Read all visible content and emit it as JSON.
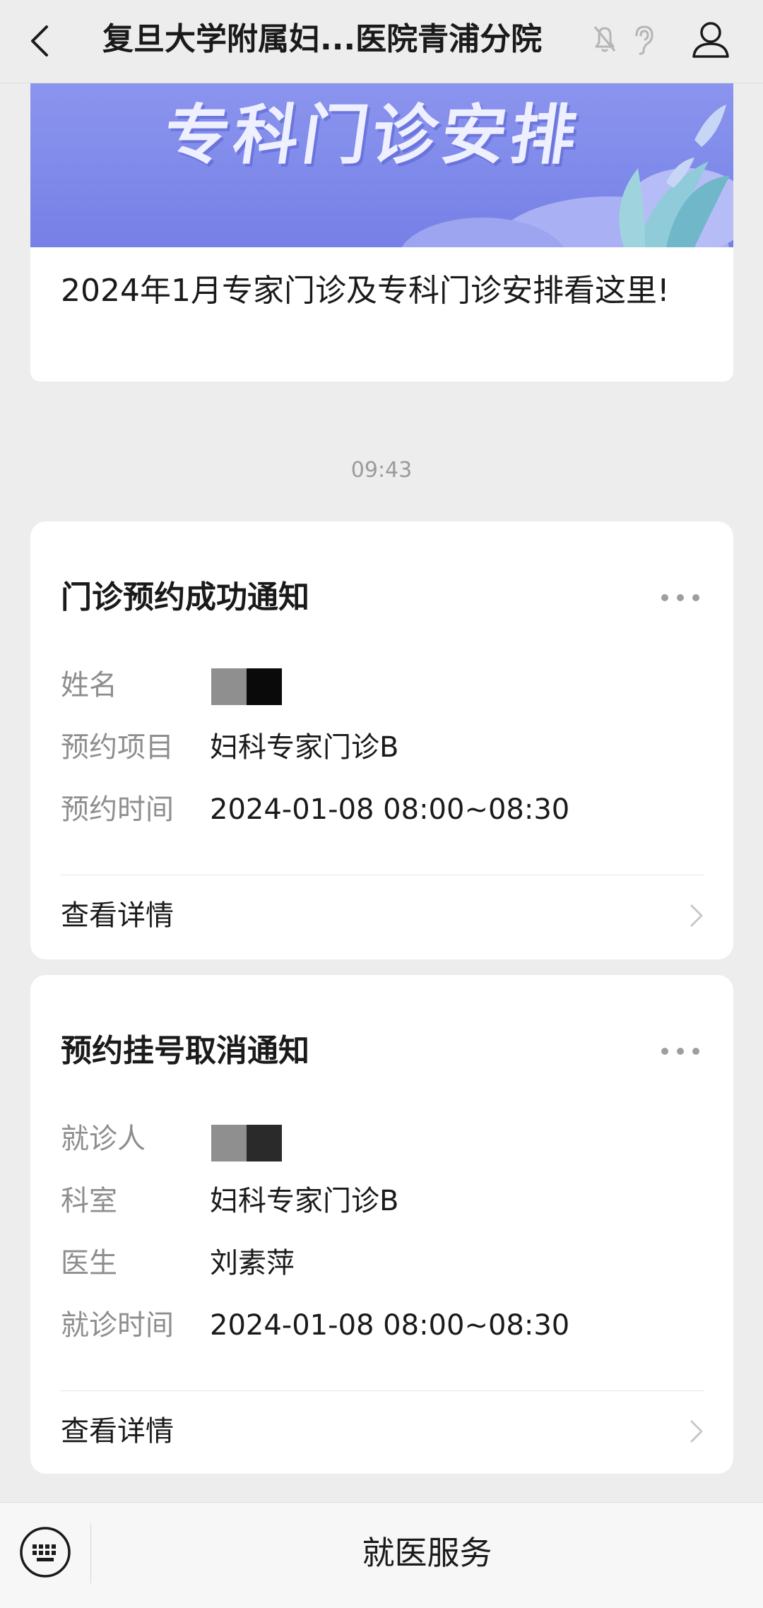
{
  "header": {
    "title": "复旦大学附属妇...医院青浦分院",
    "icons": [
      "back-icon",
      "bell-muted-icon",
      "ear-icon",
      "profile-icon"
    ]
  },
  "article": {
    "banner_text": "专科门诊安排",
    "title": "2024年1月专家门诊及专科门诊安排看这里!"
  },
  "timestamp": "09:43",
  "cards": [
    {
      "title": "门诊预约成功通知",
      "rows": [
        {
          "label": "姓名",
          "value": ""
        },
        {
          "label": "预约项目",
          "value": "妇科专家门诊B"
        },
        {
          "label": "预约时间",
          "value": "2024-01-08 08:00~08:30"
        }
      ],
      "detail_label": "查看详情"
    },
    {
      "title": "预约挂号取消通知",
      "rows": [
        {
          "label": "就诊人",
          "value": ""
        },
        {
          "label": "科室",
          "value": "妇科专家门诊B"
        },
        {
          "label": "医生",
          "value": "刘素萍"
        },
        {
          "label": "就诊时间",
          "value": "2024-01-08 08:00~08:30"
        }
      ],
      "detail_label": "查看详情"
    }
  ],
  "bottom_bar": {
    "menu_label": "就医服务"
  },
  "colors": {
    "background": "#ededed",
    "card": "#ffffff",
    "banner": "#7f89ea",
    "label_gray": "#8e8e8e"
  }
}
